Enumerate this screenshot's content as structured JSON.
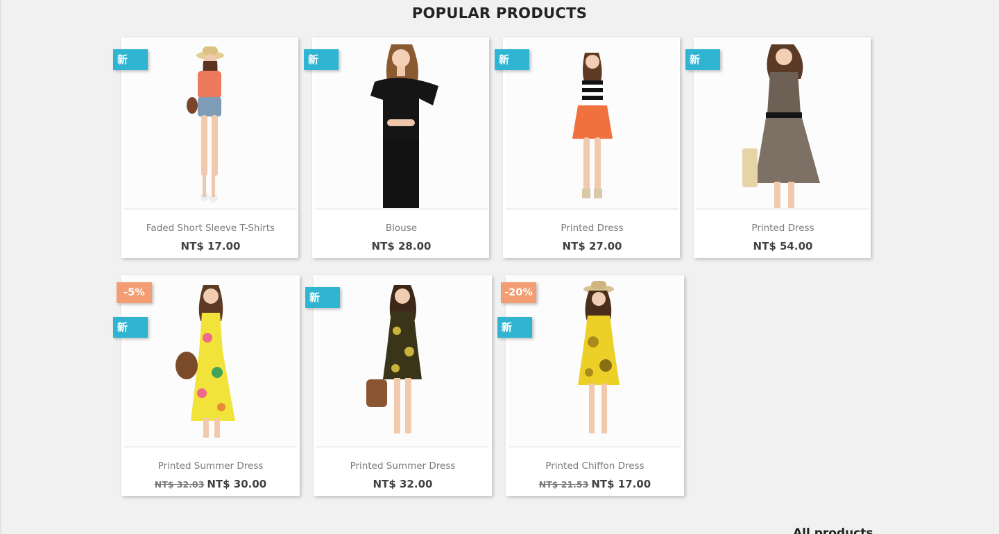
{
  "section": {
    "title": "POPULAR PRODUCTS",
    "all_products_link": "All products"
  },
  "colors": {
    "page_background": "#f1f1f1",
    "new_flag": "#2fb5d2",
    "discount_flag": "#f39d72"
  },
  "products": [
    {
      "name": "Faded Short Sleeve T-Shirts",
      "price": "NT$ 17.00",
      "regular_price": "",
      "flags": {
        "new": "新",
        "discount": ""
      },
      "image": "model-orange-top-denim-shorts"
    },
    {
      "name": "Blouse",
      "price": "NT$ 28.00",
      "regular_price": "",
      "flags": {
        "new": "新",
        "discount": ""
      },
      "image": "model-black-blouse"
    },
    {
      "name": "Printed Dress",
      "price": "NT$ 27.00",
      "regular_price": "",
      "flags": {
        "new": "新",
        "discount": ""
      },
      "image": "model-striped-top-orange-skirt"
    },
    {
      "name": "Printed Dress",
      "price": "NT$ 54.00",
      "regular_price": "",
      "flags": {
        "new": "新",
        "discount": ""
      },
      "image": "model-printed-dress"
    },
    {
      "name": "Printed Summer Dress",
      "price": "NT$ 30.00",
      "regular_price": "NT$ 32.03",
      "flags": {
        "new": "新",
        "discount": "-5%"
      },
      "image": "model-yellow-maxi-dress"
    },
    {
      "name": "Printed Summer Dress",
      "price": "NT$ 32.00",
      "regular_price": "",
      "flags": {
        "new": "新",
        "discount": ""
      },
      "image": "model-dark-print-dress"
    },
    {
      "name": "Printed Chiffon Dress",
      "price": "NT$ 17.00",
      "regular_price": "NT$ 21.53",
      "flags": {
        "new": "新",
        "discount": "-20%"
      },
      "image": "model-yellow-chiffon-dress"
    }
  ]
}
